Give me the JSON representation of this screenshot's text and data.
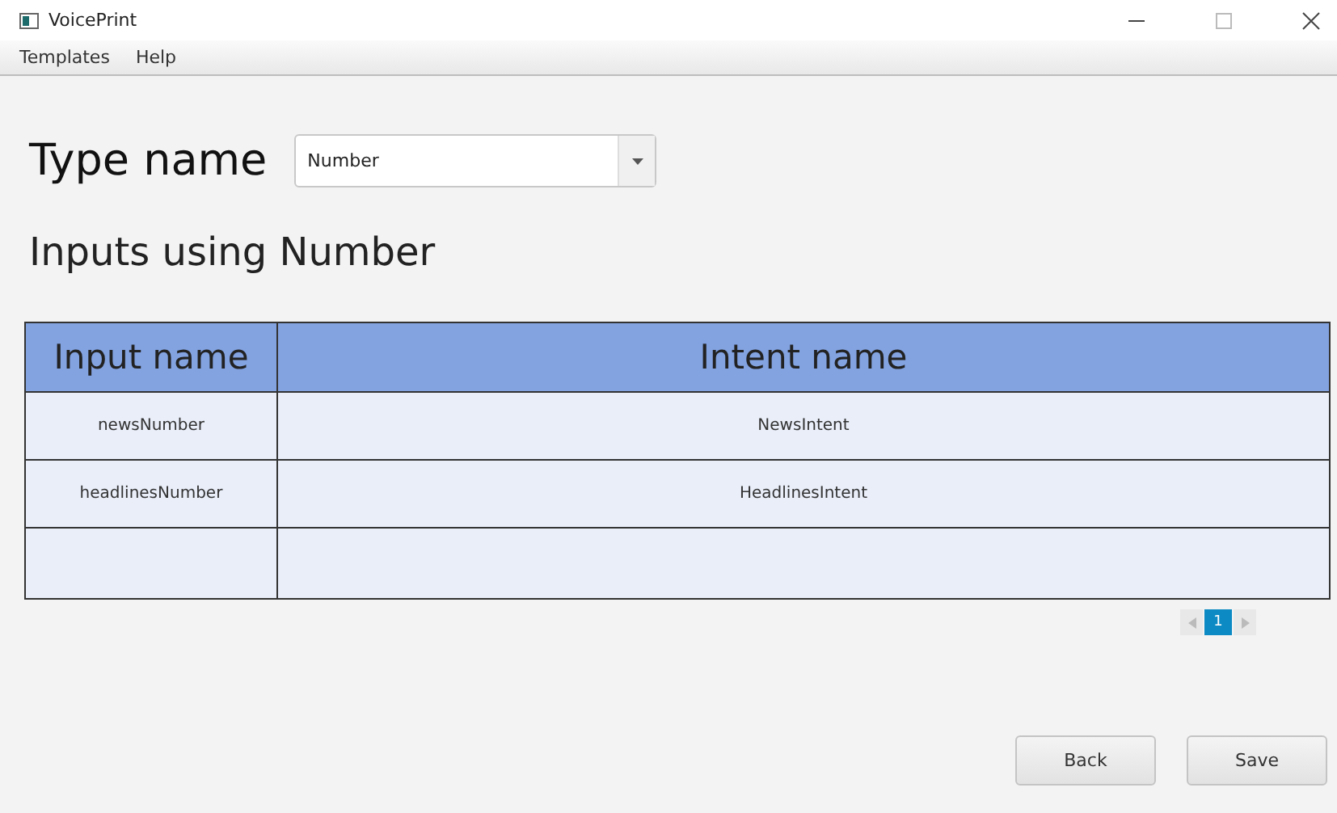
{
  "window": {
    "title": "VoicePrint"
  },
  "menu": [
    "Templates",
    "Help"
  ],
  "type_field": {
    "label": "Type name",
    "value": "Number"
  },
  "heading": "Inputs using Number",
  "table": {
    "columns": [
      "Input name",
      "Intent name"
    ],
    "rows": [
      [
        "newsNumber",
        "NewsIntent"
      ],
      [
        "headlinesNumber",
        "HeadlinesIntent"
      ]
    ]
  },
  "pagination": {
    "pages": [
      {
        "label": "1",
        "selected": true
      }
    ]
  },
  "buttons": [
    "Back",
    "Save"
  ]
}
